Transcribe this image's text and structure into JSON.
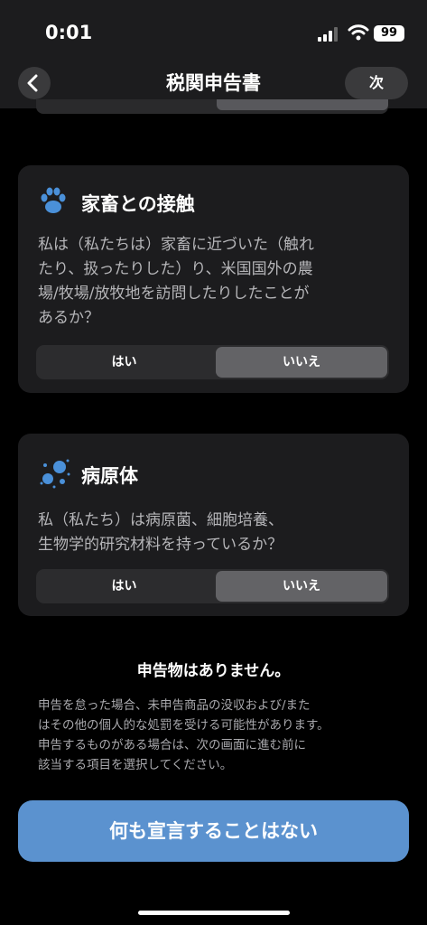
{
  "status_bar": {
    "time": "0:01",
    "battery": "99"
  },
  "nav": {
    "title": "税関申告書",
    "next": "次"
  },
  "cards": [
    {
      "title": "家畜との接触",
      "icon": "paw-icon",
      "question_lines": [
        "私は（私たちは）家畜に近づいた（触れ",
        "たり、扱ったりした）り、米国国外の農",
        "場/牧場/放牧地を訪問したりしたことが",
        "あるか？"
      ],
      "yes": "はい",
      "no": "いいえ",
      "selected": "no"
    },
    {
      "title": "病原体",
      "icon": "pathogen-icon",
      "question_lines": [
        "私（私たち）は病原菌、細胞培養、",
        "生物学的研究材料を持っているか？"
      ],
      "yes": "はい",
      "no": "いいえ",
      "selected": "no"
    }
  ],
  "summary": {
    "none_declared": "申告物はありません。",
    "warning_lines": [
      "申告を怠った場合、未申告商品の没収および/また",
      "はその他の個人的な処罰を受ける可能性があります。",
      "申告するものがある場合は、次の画面に進む前に",
      "該当する項目を選択してください。"
    ]
  },
  "cta": {
    "label": "何も宣言することはない"
  },
  "colors": {
    "accent": "#5b92cf",
    "icon_blue": "#4a90d9",
    "card_bg": "#1c1c1e"
  }
}
